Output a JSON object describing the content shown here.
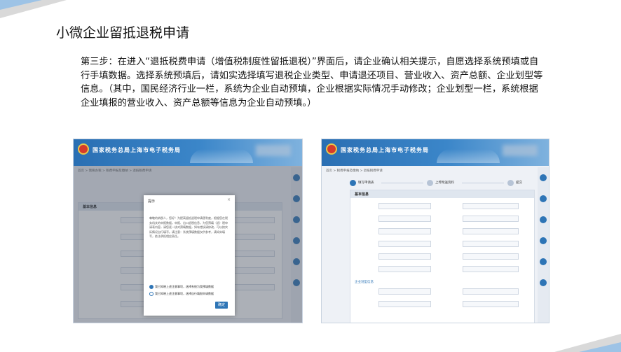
{
  "slide": {
    "title": "小微企业留抵退税申请",
    "step_text": "第三步：在进入“退抵税费申请（增值税制度性留抵退税）”界面后，请企业确认相关提示，自愿选择系统预填或自行手填数据。选择系统预填后，请如实选择填写退税企业类型、申请退还项目、营业收入、资产总额、企业划型等信息。（其中，国民经济行业一栏，系统为企业自动预填，企业根据实际情况手动修改；企业划型一栏，系统根据企业填报的营业收入、资产总额等信息为企业自动预填。）"
  },
  "colors": {
    "accent": "#2e75b6",
    "corner_blue": "#9dc3e6",
    "corner_gray": "#d9d9d9"
  },
  "left_screenshot": {
    "site_title": "国家税务总局上海市电子税务局",
    "breadcrumb": "首页 > 我要办税 > 税费申报及缴纳 > 退抵税费申请",
    "section_title": "基本信息",
    "dialog": {
      "title": "提示",
      "close_icon": "close-icon",
      "body": "尊敬的纳税人，您好！为提高留抵退税申请便利度，根据您在税务机关的申报数据，申报、出口退税信息，为您预填（退）税申请表内容，请您逐一核对预填数据，如有错误请修改，可以按实际情况自行填写。请注意：系统预填数据仅供参考，请如实填写，依法承担相应责任。",
      "option_1": "我已知晓上述注意事项，选择系统为我预填数据",
      "option_2": "我已知晓上述注意事项，选择自行填报申请数据",
      "ok_label": "确定"
    }
  },
  "right_screenshot": {
    "site_title": "国家税务总局上海市电子税务局",
    "breadcrumb": "首页 > 税费申报及缴纳 > 退抵税费申请",
    "steps": [
      "填写申请表",
      "上传附送资料",
      "提交"
    ],
    "section_title": "基本信息",
    "sub_section": "企业划型信息"
  }
}
